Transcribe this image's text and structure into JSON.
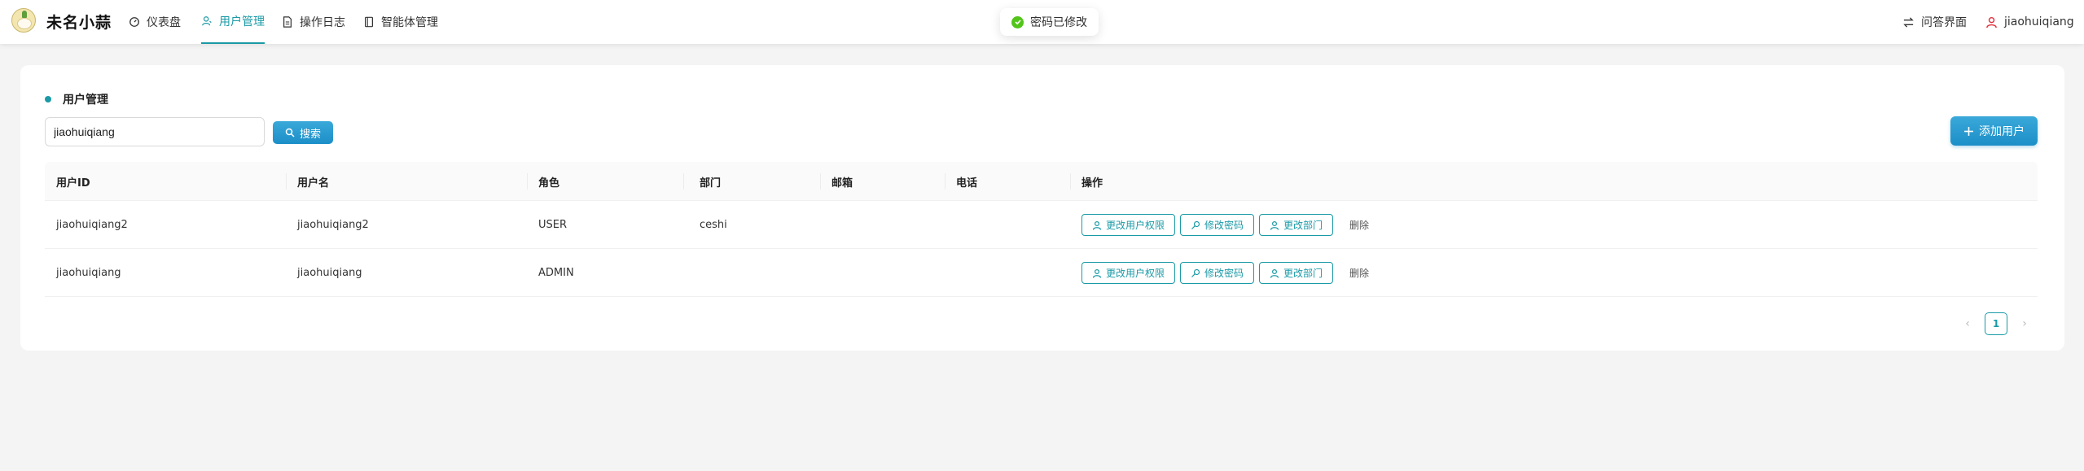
{
  "header": {
    "brand": "未名小蒜",
    "nav": [
      {
        "label": "仪表盘",
        "icon": "dashboard-icon"
      },
      {
        "label": "用户管理",
        "icon": "user-manage-icon",
        "active": true
      },
      {
        "label": "操作日志",
        "icon": "log-icon"
      },
      {
        "label": "智能体管理",
        "icon": "agent-icon"
      }
    ],
    "toast": "密码已修改",
    "qa_label": "问答界面",
    "username": "jiaohuiqiang"
  },
  "page": {
    "section_title": "用户管理",
    "search_value": "jiaohuiqiang",
    "search_label": "搜索",
    "add_label": "添加用户"
  },
  "table": {
    "columns": [
      "用户ID",
      "用户名",
      "角色",
      "部门",
      "邮箱",
      "电话",
      "操作"
    ],
    "rows": [
      {
        "id": "jiaohuiqiang2",
        "name": "jiaohuiqiang2",
        "role": "USER",
        "dept": "ceshi",
        "email": "",
        "phone": ""
      },
      {
        "id": "jiaohuiqiang",
        "name": "jiaohuiqiang",
        "role": "ADMIN",
        "dept": "",
        "email": "",
        "phone": ""
      }
    ],
    "actions": {
      "perm": "更改用户权限",
      "pwd": "修改密码",
      "dept": "更改部门",
      "delete": "删除"
    }
  },
  "pagination": {
    "current": "1",
    "prev": "‹",
    "next": "›"
  },
  "colors": {
    "accent": "#1a9aa6",
    "primary_button": "#1c8fc8",
    "success": "#52c41a"
  }
}
